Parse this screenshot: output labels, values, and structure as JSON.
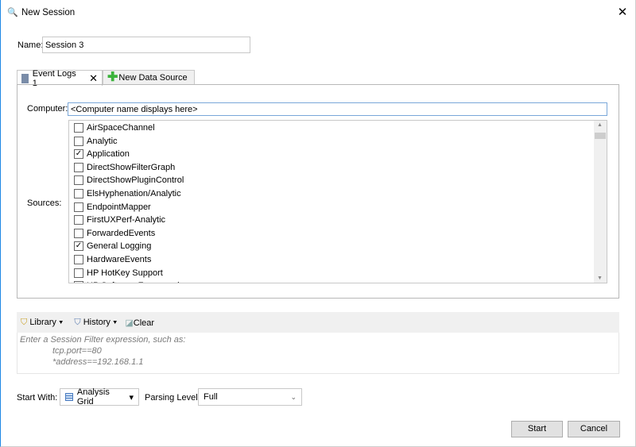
{
  "window": {
    "title": "New Session",
    "close": "✕"
  },
  "name": {
    "label": "Name:",
    "value": "Session 3"
  },
  "tabs": [
    {
      "label": "Event Logs 1",
      "close": "✕"
    },
    {
      "label": "New Data Source"
    }
  ],
  "computer": {
    "label": "Computer:",
    "value": "<Computer name displays here>"
  },
  "sources": {
    "label": "Sources:",
    "items": [
      {
        "label": "AirSpaceChannel",
        "checked": false
      },
      {
        "label": "Analytic",
        "checked": false
      },
      {
        "label": "Application",
        "checked": true
      },
      {
        "label": "DirectShowFilterGraph",
        "checked": false
      },
      {
        "label": "DirectShowPluginControl",
        "checked": false
      },
      {
        "label": "ElsHyphenation/Analytic",
        "checked": false
      },
      {
        "label": "EndpointMapper",
        "checked": false
      },
      {
        "label": "FirstUXPerf-Analytic",
        "checked": false
      },
      {
        "label": "ForwardedEvents",
        "checked": false
      },
      {
        "label": "General Logging",
        "checked": true
      },
      {
        "label": "HardwareEvents",
        "checked": false
      },
      {
        "label": "HP HotKey Support",
        "checked": false
      },
      {
        "label": "HP Software Framework",
        "checked": false
      }
    ]
  },
  "filter": {
    "library": "Library",
    "history": "History",
    "clear": "Clear",
    "hint": [
      "Enter a Session Filter expression, such as:",
      "tcp.port==80",
      "*address==192.168.1.1"
    ]
  },
  "start_with": {
    "label": "Start With:",
    "value": "Analysis Grid"
  },
  "parsing": {
    "label": "Parsing Level:",
    "value": "Full"
  },
  "buttons": {
    "start": "Start",
    "cancel": "Cancel"
  }
}
